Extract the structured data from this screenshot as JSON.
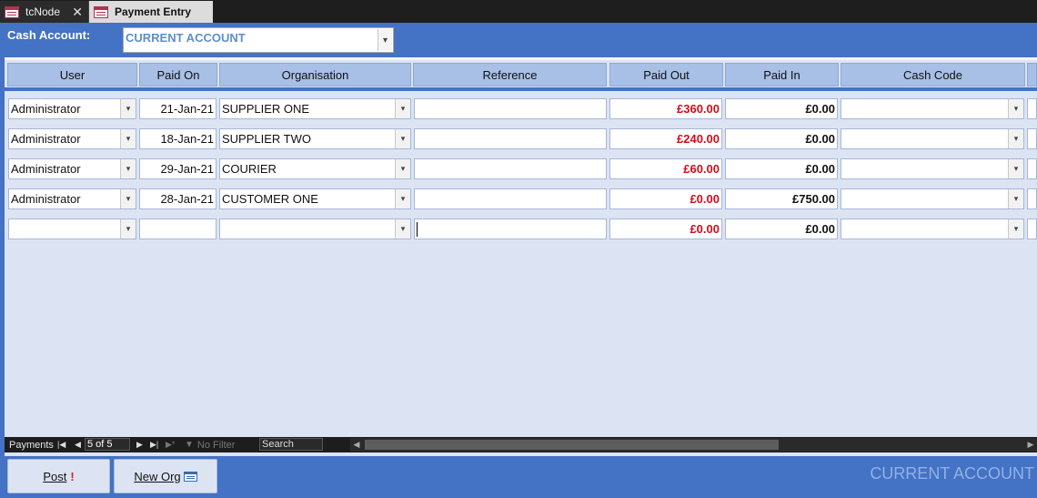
{
  "tabs": [
    {
      "label": "tcNode"
    },
    {
      "label": "Payment Entry"
    }
  ],
  "cash_account": {
    "label": "Cash Account:",
    "value": "CURRENT ACCOUNT"
  },
  "columns": [
    "User",
    "Paid On",
    "Organisation",
    "Reference",
    "Paid Out",
    "Paid In",
    "Cash Code"
  ],
  "rows": [
    {
      "user": "Administrator",
      "paid_on": "21-Jan-21",
      "organisation": "SUPPLIER ONE",
      "reference": "",
      "paid_out": "£360.00",
      "paid_in": "£0.00",
      "cash_code": ""
    },
    {
      "user": "Administrator",
      "paid_on": "18-Jan-21",
      "organisation": "SUPPLIER TWO",
      "reference": "",
      "paid_out": "£240.00",
      "paid_in": "£0.00",
      "cash_code": ""
    },
    {
      "user": "Administrator",
      "paid_on": "29-Jan-21",
      "organisation": "COURIER",
      "reference": "",
      "paid_out": "£60.00",
      "paid_in": "£0.00",
      "cash_code": ""
    },
    {
      "user": "Administrator",
      "paid_on": "28-Jan-21",
      "organisation": "CUSTOMER ONE",
      "reference": "",
      "paid_out": "£0.00",
      "paid_in": "£750.00",
      "cash_code": ""
    },
    {
      "user": "",
      "paid_on": "",
      "organisation": "",
      "reference": "",
      "paid_out": "£0.00",
      "paid_in": "£0.00",
      "cash_code": ""
    }
  ],
  "navigation": {
    "label": "Payments",
    "record": "5 of 5",
    "filter": "No Filter",
    "search": "Search"
  },
  "buttons": {
    "post": "Post",
    "new_org": "New Org"
  },
  "footer_account": "CURRENT ACCOUNT",
  "colors": {
    "header_blue": "#4472c4",
    "grid_bg": "#dce4f3",
    "column_header": "#a8bfe6",
    "negative_red": "#d10e1c"
  }
}
